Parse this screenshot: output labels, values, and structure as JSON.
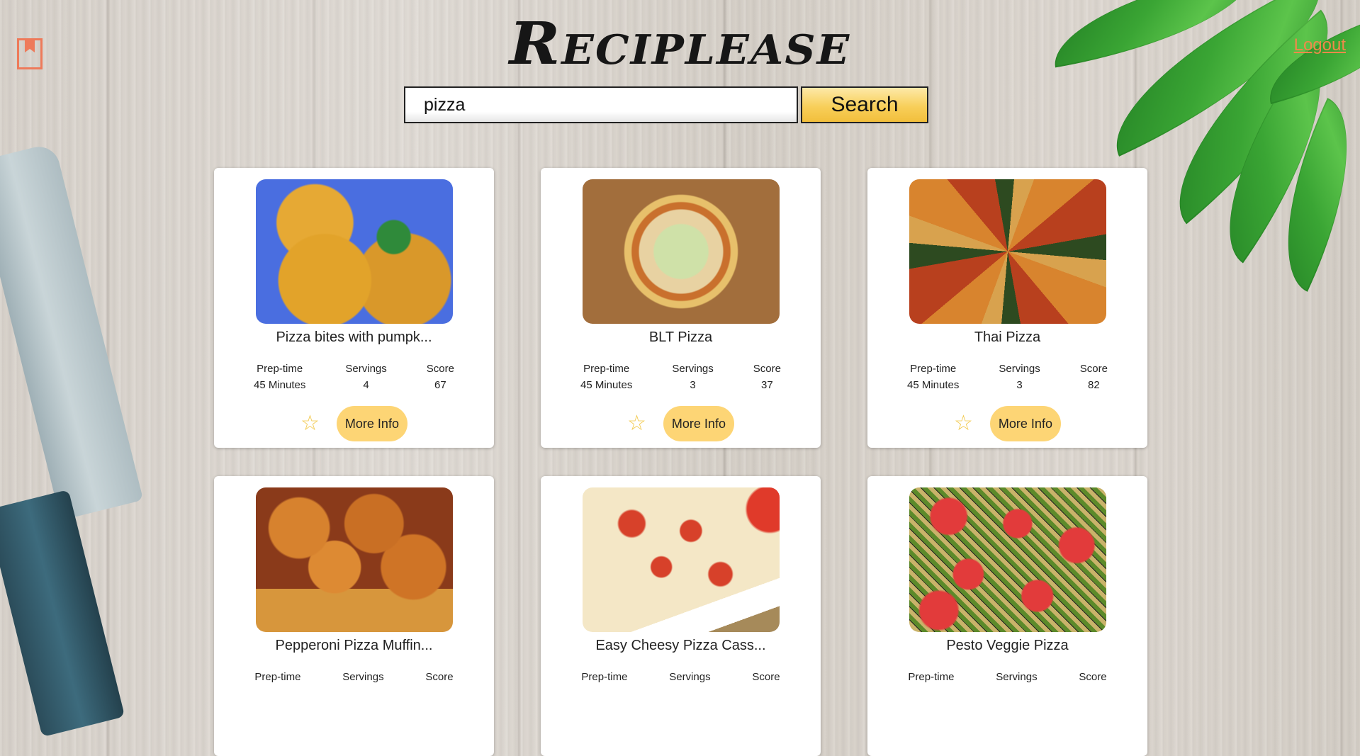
{
  "header": {
    "app_title": "Reciplease",
    "logout_label": "Logout"
  },
  "search": {
    "value": "pizza",
    "button_label": "Search"
  },
  "recipes": [
    {
      "title": "Pizza bites with pumpk...",
      "prep_label": "Prep-time",
      "prep": "45 Minutes",
      "servings_label": "Servings",
      "servings": "4",
      "score_label": "Score",
      "score": "67",
      "more_label": "More Info",
      "image": "pizza-bites-photo"
    },
    {
      "title": "BLT Pizza",
      "prep_label": "Prep-time",
      "prep": "45 Minutes",
      "servings_label": "Servings",
      "servings": "3",
      "score_label": "Score",
      "score": "37",
      "more_label": "More Info",
      "image": "blt-pizza-photo"
    },
    {
      "title": "Thai Pizza",
      "prep_label": "Prep-time",
      "prep": "45 Minutes",
      "servings_label": "Servings",
      "servings": "3",
      "score_label": "Score",
      "score": "82",
      "more_label": "More Info",
      "image": "thai-pizza-photo"
    },
    {
      "title": "Pepperoni Pizza Muffin...",
      "prep_label": "Prep-time",
      "servings_label": "Servings",
      "score_label": "Score",
      "image": "pepperoni-muffin-photo"
    },
    {
      "title": "Easy Cheesy Pizza Cass...",
      "prep_label": "Prep-time",
      "servings_label": "Servings",
      "score_label": "Score",
      "image": "pizza-casserole-photo"
    },
    {
      "title": "Pesto Veggie Pizza",
      "prep_label": "Prep-time",
      "servings_label": "Servings",
      "score_label": "Score",
      "image": "pesto-veggie-pizza-photo"
    }
  ],
  "colors": {
    "accent": "#fdd575",
    "logout": "#ee8a4a",
    "bookmark": "#ee7a5a",
    "star": "#f2c94c"
  },
  "icons": {
    "bookmark": "bookmark-icon",
    "favorite": "star-outline-icon"
  }
}
